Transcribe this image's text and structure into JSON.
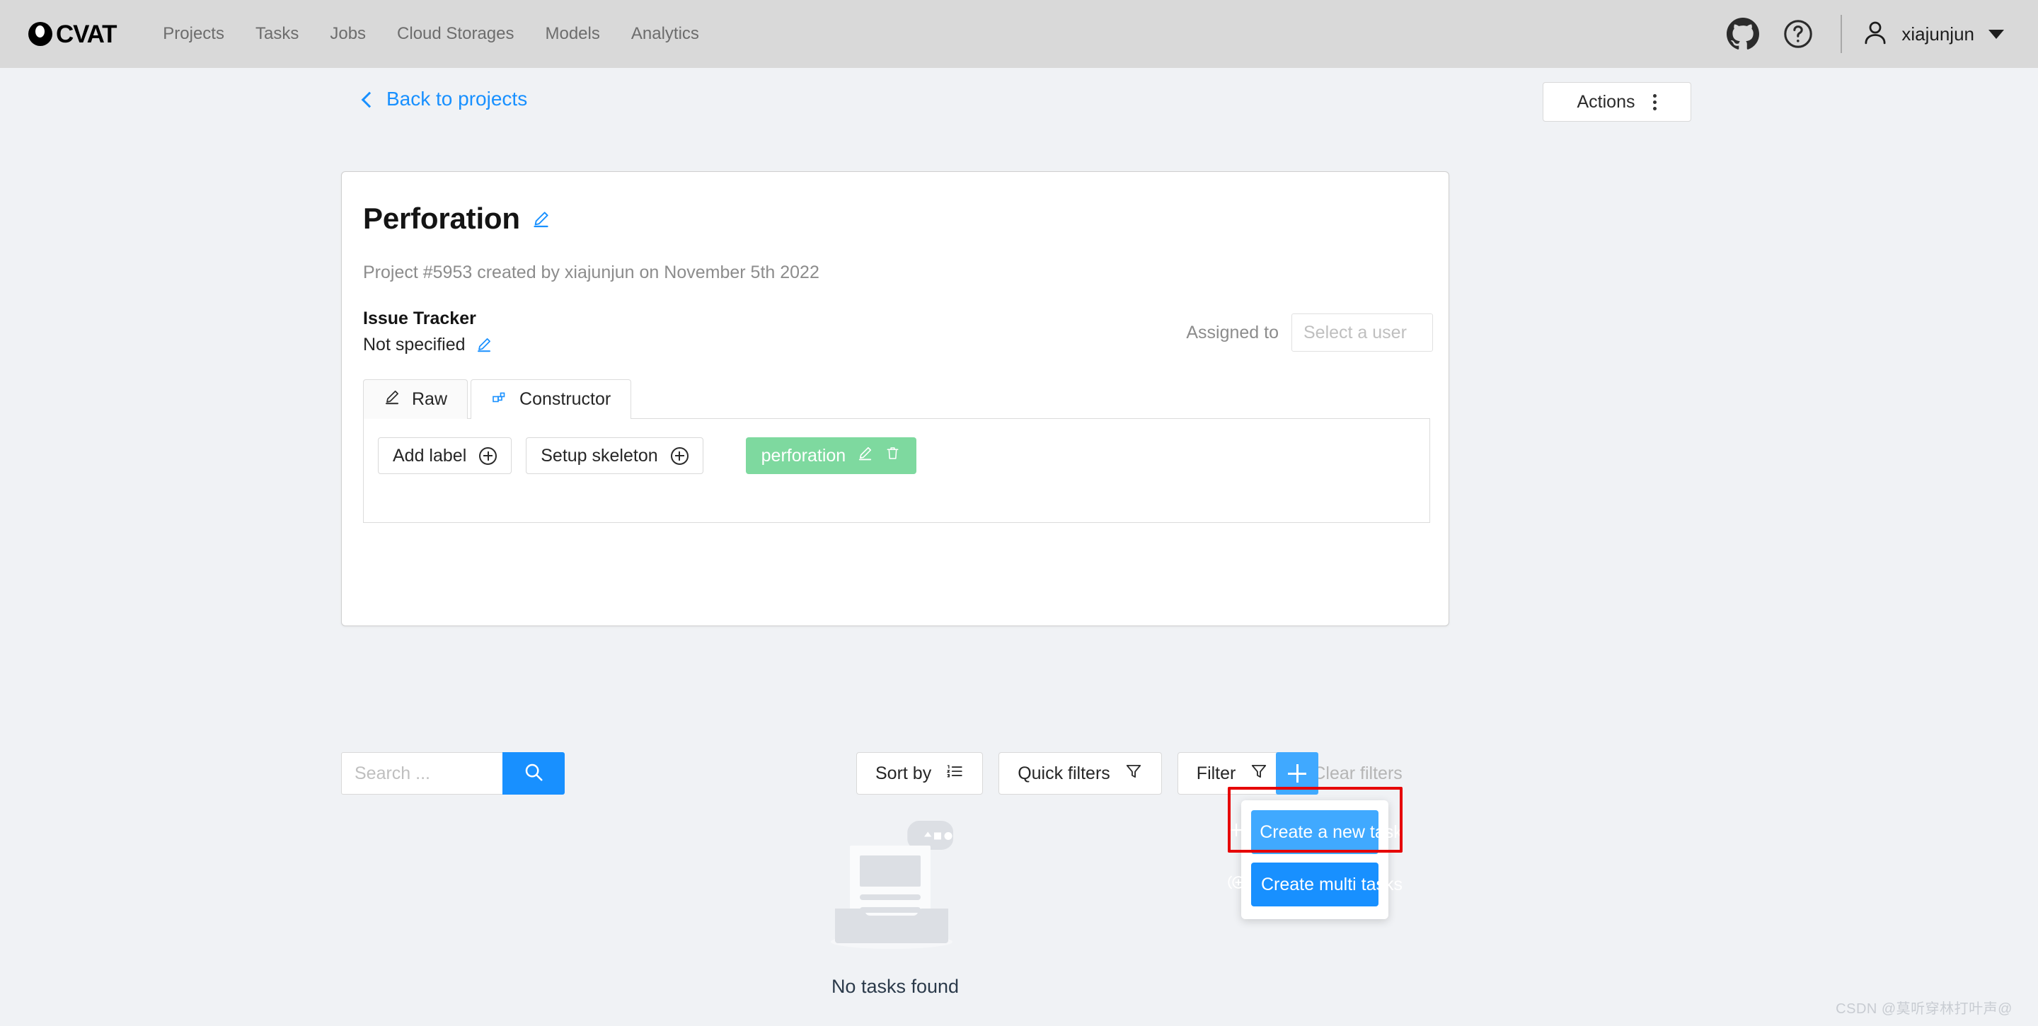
{
  "header": {
    "brand": "CVAT",
    "brand_icon": "cvat-logo-icon",
    "nav": [
      {
        "label": "Projects"
      },
      {
        "label": "Tasks"
      },
      {
        "label": "Jobs"
      },
      {
        "label": "Cloud Storages"
      },
      {
        "label": "Models"
      },
      {
        "label": "Analytics"
      }
    ],
    "github_icon": "github-icon",
    "help_icon": "question-circle-icon",
    "user": {
      "name": "xiajunjun",
      "avatar_icon": "user-icon",
      "caret_icon": "caret-down-icon"
    },
    "background": "#d9d9d9"
  },
  "subheader": {
    "back_label": "Back to projects",
    "back_icon": "chevron-left-icon",
    "back_color": "#1890ff",
    "actions_label": "Actions",
    "actions_icon": "more-vertical-icon"
  },
  "project": {
    "title": "Perforation",
    "title_edit_icon": "pencil-icon",
    "meta": "Project #5953 created by xiajunjun on November 5th 2022",
    "assigned_label": "Assigned to",
    "assigned_placeholder": "Select a user",
    "assigned_value": "",
    "issue_tracker_label": "Issue Tracker",
    "issue_tracker_value": "Not specified",
    "issue_tracker_edit_icon": "pencil-icon"
  },
  "labels_editor": {
    "tabs": [
      {
        "label": "Raw",
        "icon": "pencil-icon",
        "active": false
      },
      {
        "label": "Constructor",
        "icon": "constructor-icon",
        "active": true
      }
    ],
    "add_label_button": "Add label",
    "add_label_icon": "plus-circle-icon",
    "setup_skeleton_button": "Setup skeleton",
    "setup_skeleton_icon": "plus-circle-icon",
    "labels": [
      {
        "name": "perforation",
        "color": "#7ed99f",
        "edit_icon": "pencil-icon",
        "delete_icon": "trash-icon"
      }
    ]
  },
  "toolbar": {
    "search_placeholder": "Search ...",
    "search_value": "",
    "search_icon": "search-icon",
    "search_button_color": "#1890ff",
    "sort_by_label": "Sort by",
    "sort_by_icon": "ordered-list-icon",
    "quick_filters_label": "Quick filters",
    "quick_filters_icon": "filter-icon",
    "filter_label": "Filter",
    "filter_icon": "filter-icon",
    "clear_filters_label": "Clear filters",
    "clear_filters_disabled": true,
    "create_fab_icon": "plus-icon",
    "create_fab_color": "#40a9ff"
  },
  "create_menu": {
    "items": [
      {
        "label": "Create a new task",
        "icon": "plus-icon",
        "color": "#40a9ff",
        "highlighted": true
      },
      {
        "label": "Create multi tasks",
        "icon": "plus-circle-multi-icon",
        "color": "#1890ff",
        "highlighted": false
      }
    ],
    "highlight_color": "#e60000"
  },
  "empty_state": {
    "illustration_icon": "empty-inbox-icon",
    "text": "No tasks found"
  },
  "watermark": "CSDN @莫听穿林打叶声@"
}
